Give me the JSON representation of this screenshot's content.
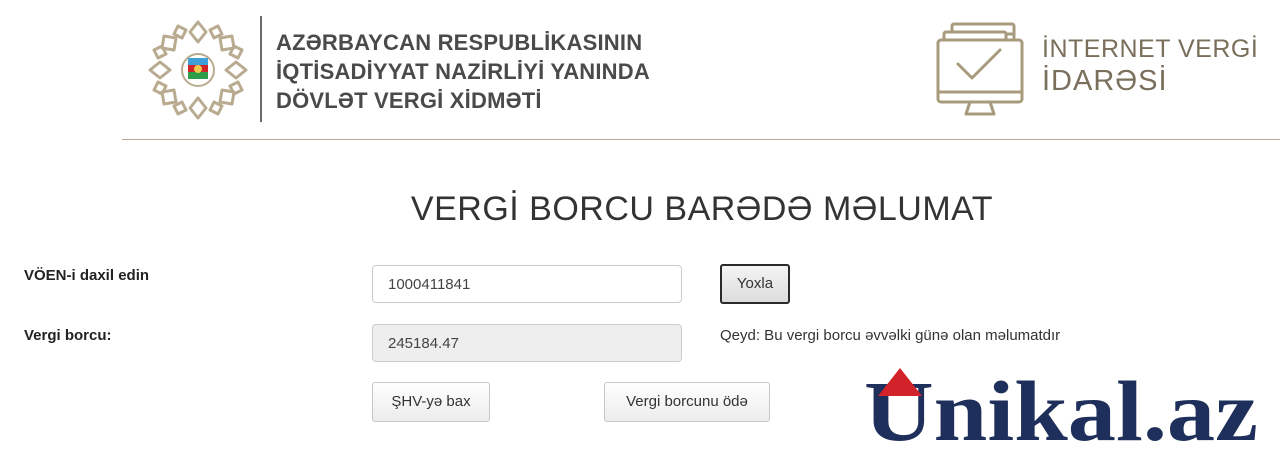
{
  "header": {
    "org_lines": [
      "AZƏRBAYCAN RESPUBLİKASININ",
      "İQTİSADİYYAT NAZİRLİYİ YANINDA",
      "DÖVLƏT VERGİ XİDMƏTİ"
    ],
    "brand_line1": "İNTERNET VERGİ",
    "brand_line2": "İDARƏSİ",
    "emblem_icon": "state-emblem-icon",
    "brand_icon": "monitor-check-icon"
  },
  "page": {
    "title": "VERGİ BORCU BARƏDƏ MƏLUMAT"
  },
  "form": {
    "voen_label": "VÖEN-i daxil edin",
    "voen_value": "1000411841",
    "check_button": "Yoxla",
    "debt_label": "Vergi borcu:",
    "debt_value": "245184.47",
    "note": "Qeyd: Bu vergi borcu əvvəlki günə olan məlumatdır",
    "shv_button": "ŞHV-yə bax",
    "pay_button": "Vergi borcunu ödə"
  },
  "watermark": {
    "text": "Unikal.az"
  },
  "colors": {
    "gold": "#b9ab8f",
    "brand_navy": "#1f2f5b",
    "brand_red": "#d2232a"
  }
}
